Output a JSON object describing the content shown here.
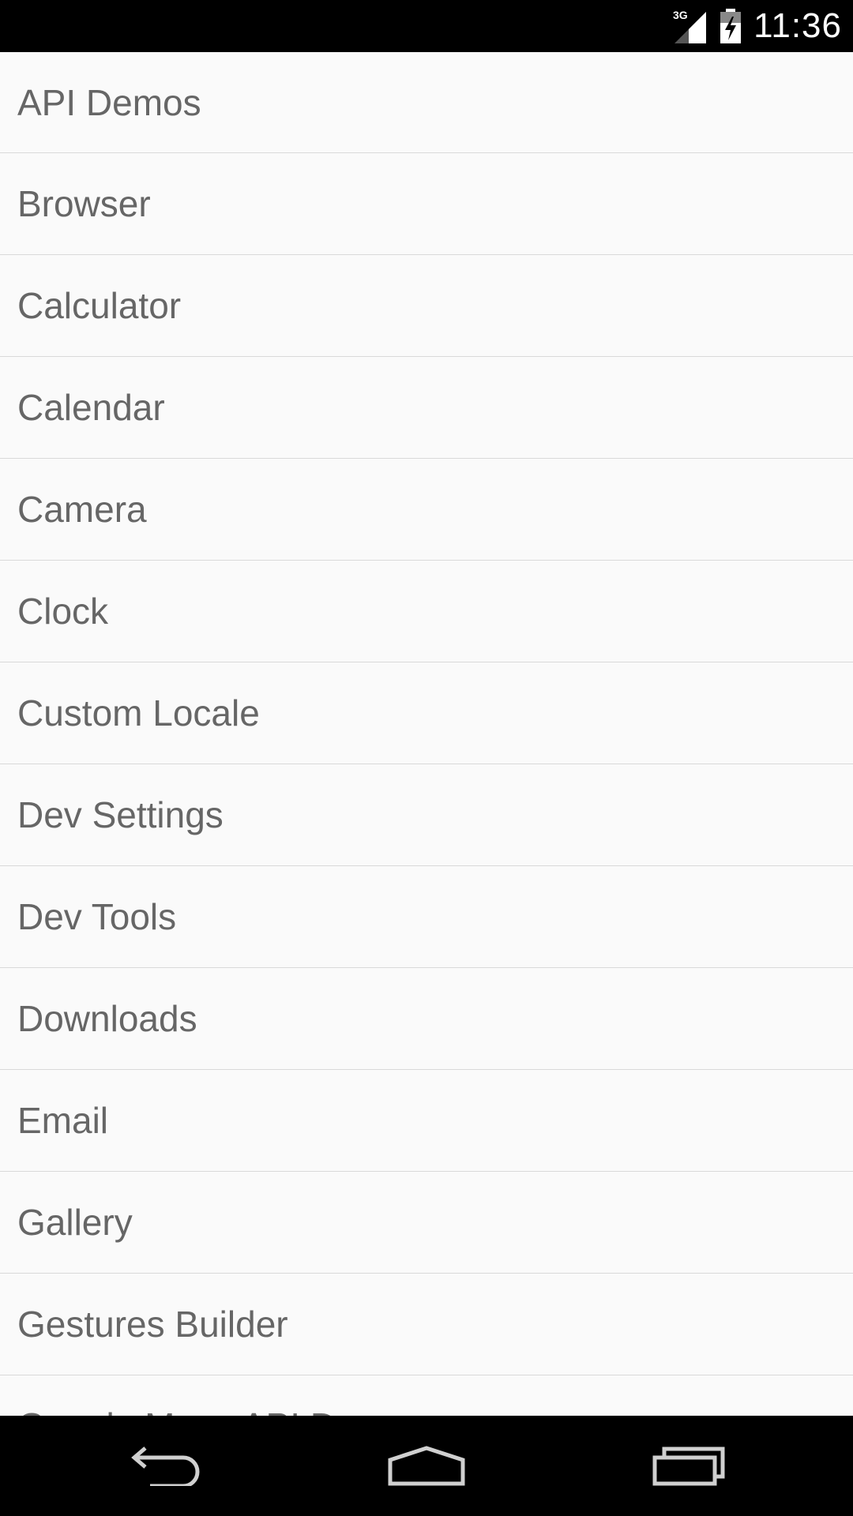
{
  "status_bar": {
    "network_type": "3G",
    "time": "11:36",
    "icons": [
      "signal-icon",
      "battery-charging-icon"
    ]
  },
  "app_list": {
    "items": [
      {
        "label": "API Demos"
      },
      {
        "label": "Browser"
      },
      {
        "label": "Calculator"
      },
      {
        "label": "Calendar"
      },
      {
        "label": "Camera"
      },
      {
        "label": "Clock"
      },
      {
        "label": "Custom Locale"
      },
      {
        "label": "Dev Settings"
      },
      {
        "label": "Dev Tools"
      },
      {
        "label": "Downloads"
      },
      {
        "label": "Email"
      },
      {
        "label": "Gallery"
      },
      {
        "label": "Gestures Builder"
      },
      {
        "label": "Google Maps API D..."
      }
    ]
  },
  "nav_bar": {
    "buttons": [
      "back-icon",
      "home-icon",
      "recents-icon"
    ]
  },
  "colors": {
    "list_background": "#fafafa",
    "divider": "#d9d9d9",
    "item_text": "#666666",
    "system_bars": "#000000"
  }
}
